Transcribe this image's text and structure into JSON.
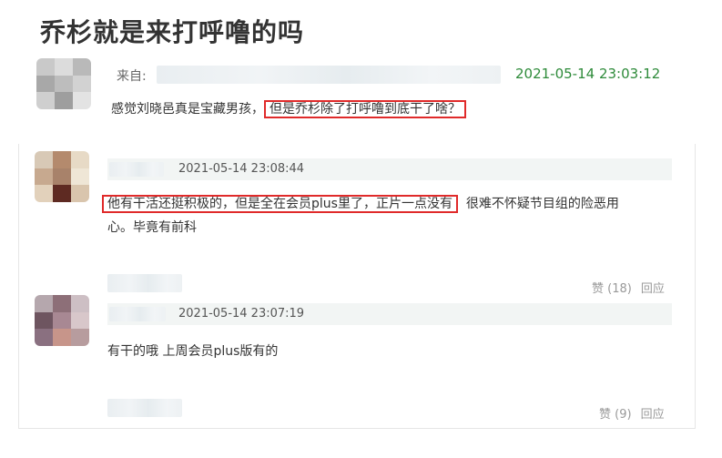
{
  "post": {
    "title": "乔杉就是来打呼噜的吗",
    "from_label": "来自:",
    "date": "2021-05-14 23:03:12",
    "text_plain": "感觉刘晓邑真是宝藏男孩，",
    "text_highlighted": "但是乔杉除了打呼噜到底干了啥？"
  },
  "replies": [
    {
      "date": "2021-05-14 23:08:44",
      "text_highlighted": "他有干活还挺积极的，但是全在会员plus里了，正片一点没有",
      "text_rest": "很难不怀疑节目组的险恶用",
      "text_line2": "心。毕竟有前科",
      "like_label": "赞 (18)",
      "reply_label": "回应"
    },
    {
      "date": "2021-05-14 23:07:19",
      "text": "有干的哦 上周会员plus版有的",
      "like_label": "赞 (9)",
      "reply_label": "回应"
    }
  ],
  "colors": {
    "accent_green": "#2e8b3a",
    "highlight_red": "#e02a2a"
  }
}
